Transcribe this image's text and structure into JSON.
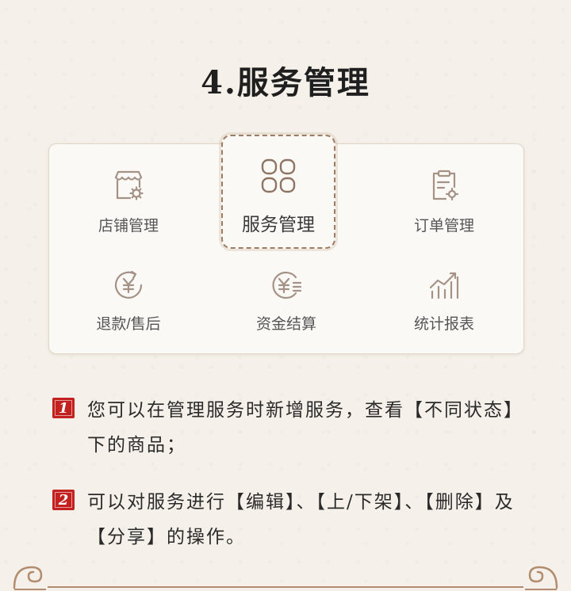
{
  "title": "4.服务管理",
  "menu": {
    "items": [
      {
        "label": "店铺管理",
        "icon": "storefront-gear-icon"
      },
      {
        "label": "服务管理",
        "icon": "grid-four-icon",
        "active": true
      },
      {
        "label": "订单管理",
        "icon": "clipboard-gear-icon"
      },
      {
        "label": "退款/售后",
        "icon": "yen-refund-icon"
      },
      {
        "label": "资金结算",
        "icon": "yen-ledger-icon"
      },
      {
        "label": "统计报表",
        "icon": "bar-chart-trend-icon"
      }
    ]
  },
  "steps": [
    {
      "num": "1",
      "text": "您可以在管理服务时新增服务，查看【不同状态】下的商品；"
    },
    {
      "num": "2",
      "text": "可以对服务进行【编辑】、【上/下架】、【删除】及【分享】的操作。"
    }
  ],
  "colors": {
    "accent": "#c3211f",
    "icon": "#a59286",
    "dash": "#9e7b63"
  }
}
